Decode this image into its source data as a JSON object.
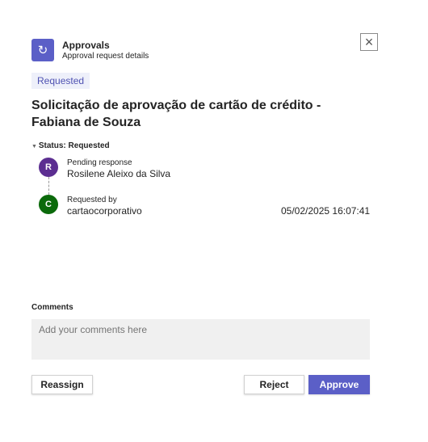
{
  "header": {
    "app_name": "Approvals",
    "subtitle": "Approval request details",
    "close_icon": "close-icon",
    "app_icon": "approvals-icon",
    "accent": "#5b5fc7"
  },
  "badge": "Requested",
  "title": "Solicitação de aprovação de cartão de crédito - Fabiana de Souza",
  "status": {
    "label": "Status: Requested",
    "entries": [
      {
        "initial": "R",
        "role": "Pending response",
        "name": "Rosilene Aleixo da Silva",
        "color": "#5c2e91"
      },
      {
        "initial": "C",
        "role": "Requested by",
        "name": "cartaocorporativo",
        "timestamp": "05/02/2025 16:07:41",
        "color": "#0b6a0b"
      }
    ]
  },
  "comments": {
    "label": "Comments",
    "placeholder": "Add your comments here"
  },
  "buttons": {
    "reassign": "Reassign",
    "reject": "Reject",
    "approve": "Approve"
  }
}
